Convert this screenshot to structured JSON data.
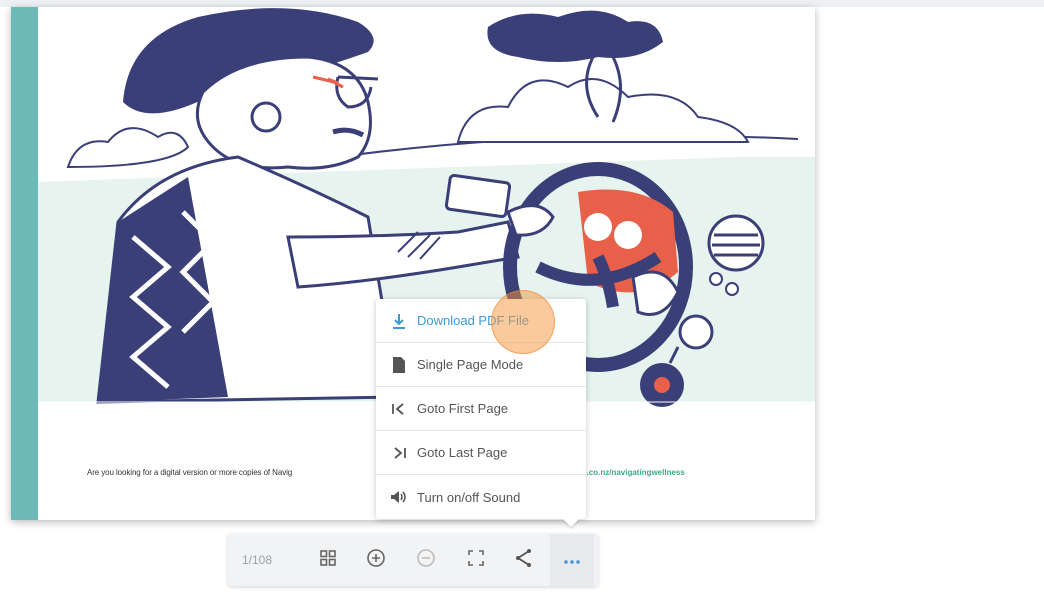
{
  "page": {
    "footer_text": "Are you looking for a digital version or more copies of Navig",
    "footer_link": "th.co.nz/navigatingwellness"
  },
  "menu": {
    "items": [
      {
        "label": "Download PDF File",
        "icon": "download-icon"
      },
      {
        "label": "Single Page Mode",
        "icon": "document-icon"
      },
      {
        "label": "Goto First Page",
        "icon": "first-page-icon"
      },
      {
        "label": "Goto Last Page",
        "icon": "last-page-icon"
      },
      {
        "label": "Turn on/off Sound",
        "icon": "speaker-icon"
      }
    ]
  },
  "toolbar": {
    "page_count": "1/108",
    "buttons": [
      "thumbnails-icon",
      "zoom-in-icon",
      "zoom-out-icon",
      "fullscreen-icon",
      "share-icon",
      "more-icon"
    ]
  },
  "colors": {
    "accent": "#3a9bd5",
    "teal": "#6cb9b5",
    "navy": "#3b3f78",
    "coral": "#e8604a",
    "mint": "#e6f3ee",
    "highlight": "#f5963c"
  }
}
